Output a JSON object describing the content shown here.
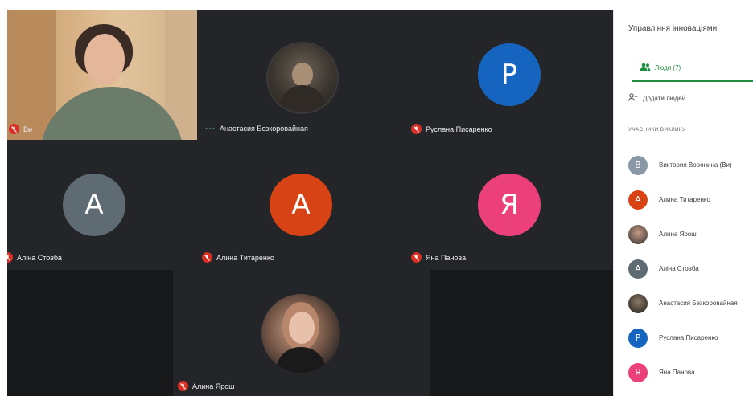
{
  "meeting": {
    "self": {
      "label": "Ви"
    },
    "tiles": [
      {
        "name": "Анастасия Безкоровайная",
        "status": "···"
      },
      {
        "name": "Руслана Писаренко",
        "initial": "Р",
        "color": "#1565c0"
      },
      {
        "name": "Аліна Стовба",
        "initial": "А",
        "color": "#5f6b73"
      },
      {
        "name": "Алина Титаренко",
        "initial": "А",
        "color": "#d84315"
      },
      {
        "name": "Яна Панова",
        "initial": "Я",
        "color": "#ec407a"
      },
      {
        "name": "Алина Ярош"
      }
    ]
  },
  "panel": {
    "title": "Управління інноваціями",
    "tab_people": "Люди (7)",
    "add_people": "Додати людей",
    "section": "УЧАСНИКИ ВИКЛИКУ",
    "people": [
      {
        "name": "Виктория Воронина (Ви)",
        "initial": "В",
        "color": "#8a97a6"
      },
      {
        "name": "Алина Титаренко",
        "initial": "А",
        "color": "#d84315"
      },
      {
        "name": "Алина Ярош",
        "initial": "",
        "color": "#6d5a52"
      },
      {
        "name": "Аліна Стовба",
        "initial": "А",
        "color": "#5f6b73"
      },
      {
        "name": "Анастасия Безкоровайная",
        "initial": "",
        "color": "#4a4238"
      },
      {
        "name": "Руслана Писаренко",
        "initial": "Р",
        "color": "#1565c0"
      },
      {
        "name": "Яна Панова",
        "initial": "Я",
        "color": "#ec407a"
      }
    ]
  }
}
